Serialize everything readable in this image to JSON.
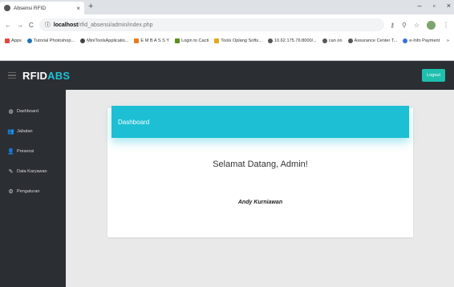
{
  "browser": {
    "tab_title": "Absensi RFID",
    "tab_close": "×",
    "new_tab": "+",
    "window_controls": [
      "–",
      "▫",
      "×"
    ],
    "url_host": "localhost",
    "url_path": "/rfid_absensi/admin/index.php",
    "bookmarks": [
      {
        "label": "Apps",
        "color": "#e8453c"
      },
      {
        "label": "Tutorial Photoshop...",
        "color": "#1e73be"
      },
      {
        "label": "MiniToolsApplicatio...",
        "color": "#444444"
      },
      {
        "label": "E M B A S S Y",
        "color": "#e87a1e"
      },
      {
        "label": "Login to Cacti",
        "color": "#5a8f1f"
      },
      {
        "label": "Tools Oplang Softs...",
        "color": "#e0a81c"
      },
      {
        "label": "10.62.175.76:8000/...",
        "color": "#555555"
      },
      {
        "label": "can on",
        "color": "#555555"
      },
      {
        "label": "Assurance Center T...",
        "color": "#555555"
      },
      {
        "label": "e-Info Payment",
        "color": "#3b6fd6"
      }
    ],
    "bookmarks_more": "»"
  },
  "header": {
    "brand_main": "RFID",
    "brand_accent": "ABS",
    "logout_label": "Logout"
  },
  "sidebar": {
    "items": [
      {
        "label": "Dashboard",
        "icon": "dashboard-icon"
      },
      {
        "label": "Jabatan",
        "icon": "users-icon"
      },
      {
        "label": "Presensi",
        "icon": "user-icon"
      },
      {
        "label": "Data Karyawan",
        "icon": "edit-icon"
      },
      {
        "label": "Pengaturan",
        "icon": "gear-icon"
      }
    ]
  },
  "main": {
    "card_title": "Dashboard",
    "welcome_text": "Selamat Datang, Admin!",
    "user_name": "Andy Kurniawan"
  },
  "colors": {
    "accent": "#1cbfd4",
    "logout_button": "#1fbfae",
    "header_bg": "#2b2e33"
  }
}
